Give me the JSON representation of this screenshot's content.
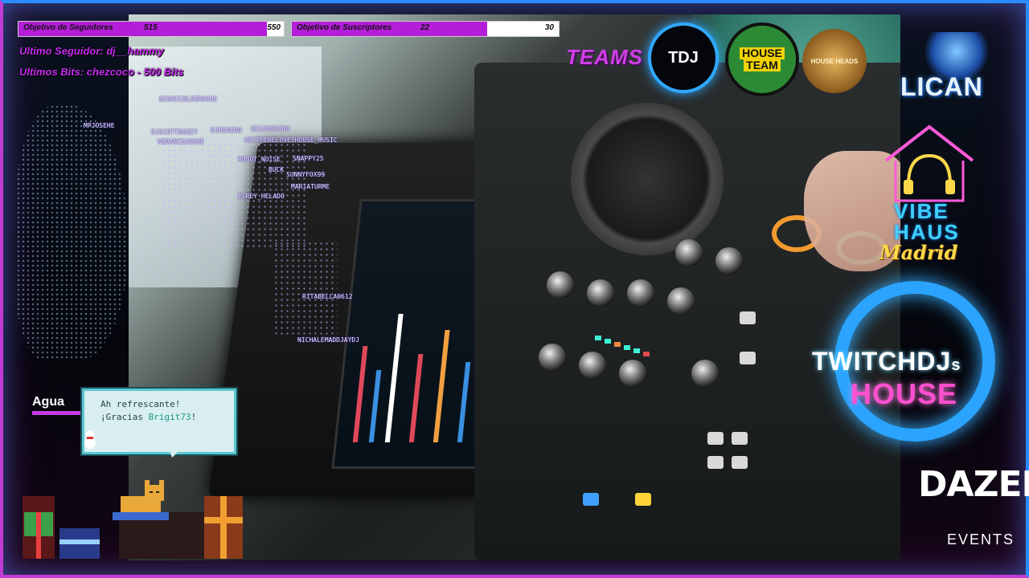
{
  "goals": {
    "followers": {
      "label": "Objetivo de Seguidores",
      "current": "515",
      "target": "550",
      "progress": 0.936
    },
    "subscribers": {
      "label": "Objetivo de Suscriptores",
      "current": "22",
      "target": "30",
      "progress": 0.733
    }
  },
  "overlay": {
    "last_follower": "Ultimo Seguidor: dj__hammy",
    "last_bits": "Ultimos Bits: chezcoco - 500 Bits"
  },
  "chatters": [
    "BIONICBLUEROGUE",
    "DJSCOTTDUGEY",
    "DJMINERO",
    "GILMAGSINO",
    "WEDANCEASONE",
    "HEYTHERELOVESHOUSE_MUSIC",
    "ROBOT_NOISE",
    "SNAPPY25",
    "BUCK",
    "SUNNYFOX99",
    "MARIATURME",
    "ELREY_HELADO",
    "RITABELLA0612",
    "NICHALEMADDJAYDJ",
    "MPJOSEHE"
  ],
  "teams": {
    "label": "TEAMS",
    "badges": {
      "tdj": "TDJ",
      "house_team_1": "HOUSE",
      "house_team_2": "TEAM",
      "house_heads": "HOUSE HEADS"
    }
  },
  "branding": {
    "lican": "LICAN",
    "vibe_1": "VIBE",
    "vibe_2": "HAUS",
    "vibe_3": "Madrid",
    "twitch_1": "TWITCHDJ",
    "twitch_1_suffix": "s",
    "twitch_2": "HOUSE",
    "dazed_1": "DAZED",
    "dazed_2": "EVENTS"
  },
  "water_widget": {
    "label": "Agua",
    "line1": "Ah refrescante!",
    "line2_prefix": "¡Gracias ",
    "line2_name": "Brigit73",
    "line2_suffix": "!"
  },
  "colors": {
    "accent_purple": "#b51ed8",
    "accent_blue": "#2aa4ff",
    "accent_pink": "#ff4fd0"
  }
}
